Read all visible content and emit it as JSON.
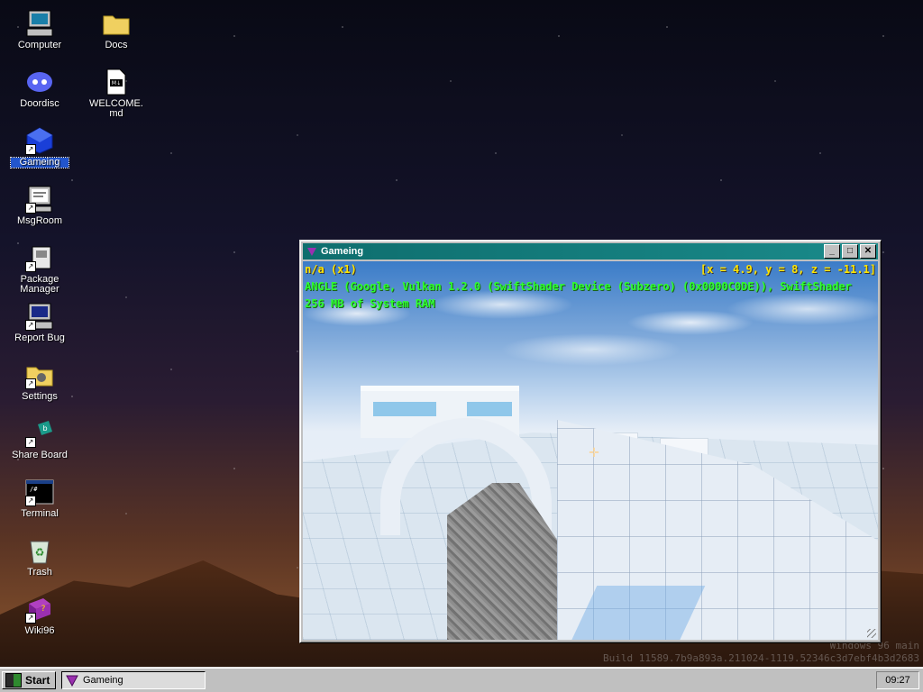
{
  "desktop": {
    "icons": [
      {
        "label": "Computer",
        "icon": "computer-icon"
      },
      {
        "label": "Docs",
        "icon": "folder-icon"
      },
      {
        "label": "Doordisc",
        "icon": "discord-icon"
      },
      {
        "label": "WELCOME.md",
        "icon": "markdown-file-icon"
      },
      {
        "label": "Gameing",
        "icon": "game-cube-icon"
      },
      {
        "label": "MsgRoom",
        "icon": "chat-computer-icon"
      },
      {
        "label": "Package Manager",
        "icon": "package-icon"
      },
      {
        "label": "Report Bug",
        "icon": "bug-report-icon"
      },
      {
        "label": "Settings",
        "icon": "settings-folder-icon"
      },
      {
        "label": "Share Board",
        "icon": "share-board-icon"
      },
      {
        "label": "Terminal",
        "icon": "terminal-icon"
      },
      {
        "label": "Trash",
        "icon": "recycle-bin-icon"
      },
      {
        "label": "Wiki96",
        "icon": "wiki-book-icon"
      }
    ],
    "watermark": {
      "line1": "Windows 96 main",
      "line2": "Build 11589.7b9a893a.211024-1119.52346c3d7ebf4b3d2683"
    }
  },
  "window": {
    "title": "Gameing",
    "controls": {
      "minimize": "_",
      "maximize": "□",
      "close": "✕"
    },
    "hud": {
      "fps": "n/a (x1)",
      "coords": "[x = 4.9, y = 8, z = -11.1]",
      "renderer": "ANGLE (Google, Vulkan 1.2.0 (SwiftShader Device (Subzero) (0x0000C0DE)), SwiftShader",
      "memory": "256 MB of System RAM"
    }
  },
  "taskbar": {
    "start_label": "Start",
    "task_label": "Gameing",
    "clock": "09:27"
  },
  "colors": {
    "titlebar": "#0e6e6e",
    "hud_yellow": "#ffe400",
    "hud_green": "#2fff2f",
    "selection": "#2255cc"
  }
}
